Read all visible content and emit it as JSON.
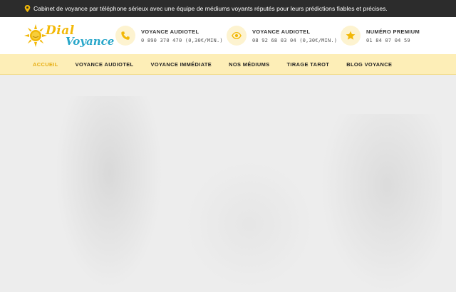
{
  "topbar": {
    "icon": "location-pin-icon",
    "text": "Cabinet de voyance par téléphone sérieux avec une équipe de médiums voyants réputés pour leurs prédictions fiables et précises."
  },
  "logo": {
    "word1": "Dial",
    "word2": "Voyance",
    "colors": {
      "primary": "#f2b807",
      "secondary": "#27a6c9"
    }
  },
  "contacts": [
    {
      "icon": "phone-icon",
      "title": "VOYANCE AUDIOTEL",
      "number": "0 890 370 470 (0,30€/MIN.)"
    },
    {
      "icon": "eye-icon",
      "title": "VOYANCE AUDIOTEL",
      "number": "08 92 68 03 04 (0,30€/MIN.)"
    },
    {
      "icon": "star-icon",
      "title": "NUMÉRO PREMIUM",
      "number": "01 84 07 04 59"
    }
  ],
  "nav": {
    "items": [
      {
        "label": "ACCUEIL",
        "active": true
      },
      {
        "label": "VOYANCE AUDIOTEL",
        "active": false
      },
      {
        "label": "VOYANCE IMMÉDIATE",
        "active": false
      },
      {
        "label": "NOS MÉDIUMS",
        "active": false
      },
      {
        "label": "TIRAGE TAROT",
        "active": false
      },
      {
        "label": "BLOG VOYANCE",
        "active": false
      }
    ]
  },
  "theme": {
    "accent": "#f2b807",
    "nav_background": "#fdeeb7",
    "topbar_background": "#2c2c2c",
    "hero_background": "#ededed"
  }
}
